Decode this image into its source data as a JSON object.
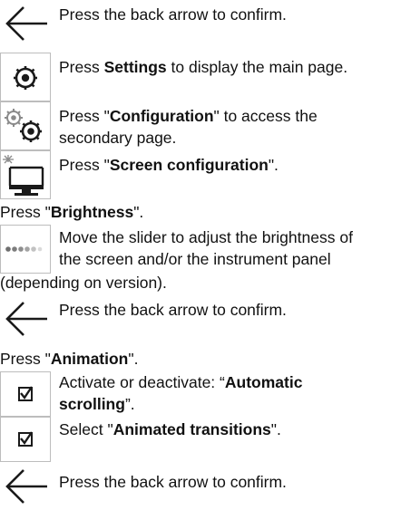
{
  "steps": {
    "s1": "Press the back arrow to confirm.",
    "s2_pre": "Press ",
    "s2_bold": "Settings",
    "s2_post": " to display the main page.",
    "s3_pre": "Press \"",
    "s3_bold": "Configuration",
    "s3_post": "\" to access the secondary page.",
    "s4_pre": "Press \"",
    "s4_bold": "Screen configuration",
    "s4_post": "\".",
    "s5_pre": "Press \"",
    "s5_bold": "Brightness",
    "s5_post": "\".",
    "s6_line1": "Move the slider to adjust the brightness of",
    "s6_line2": "the screen and/or the instrument panel",
    "s6_line3": "(depending on version).",
    "s7": "Press the back arrow to confirm.",
    "s8_pre": "Press \"",
    "s8_bold": "Animation",
    "s8_post": "\".",
    "s9_pre": "Activate or deactivate: “",
    "s9_bold": "Automatic scrolling",
    "s9_post": "”.",
    "s10_pre": "Select \"",
    "s10_bold": "Animated transitions",
    "s10_post": "\".",
    "s11": "Press the back arrow to confirm."
  },
  "icons": {
    "back": "back-arrow-icon",
    "settings": "settings-gear-icon",
    "configuration": "configuration-gears-icon",
    "screen": "screen-brightness-icon",
    "slider": "brightness-slider-icon",
    "checkbox": "checkbox-icon"
  },
  "colors": {
    "text": "#111111",
    "icon": "#1a1a1a",
    "border": "#bdbdbd",
    "grey": "#8a8a8a"
  }
}
